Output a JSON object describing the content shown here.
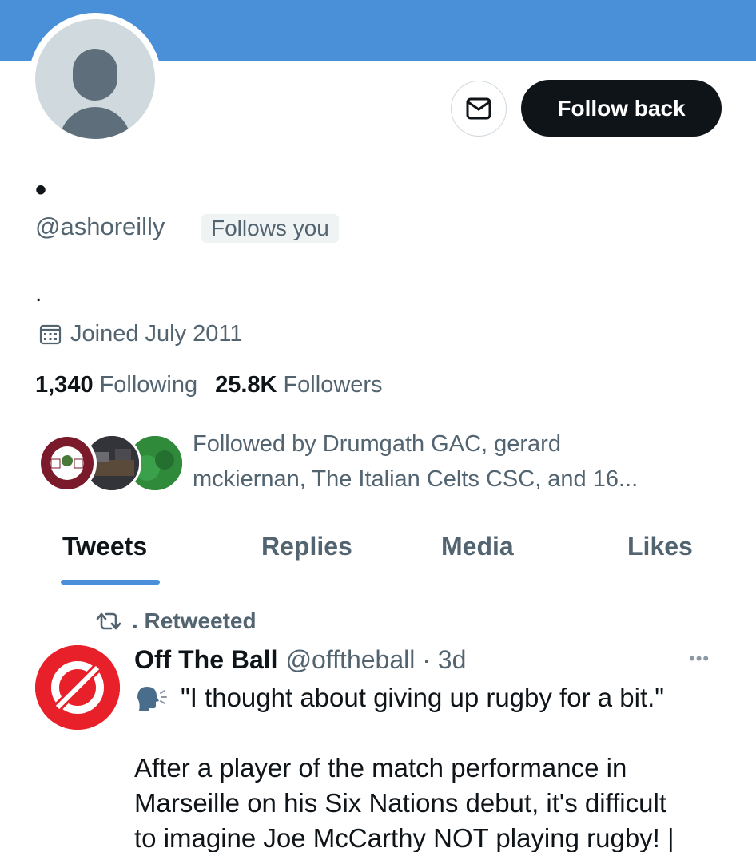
{
  "colors": {
    "banner": "#4a90d9",
    "primary_text": "#0f1419",
    "secondary_text": "#536471",
    "follow_button_bg": "#0f1419",
    "tab_indicator": "#4a8fda",
    "off_the_ball_red": "#e8202a"
  },
  "header": {
    "message_icon": "envelope-icon",
    "follow_button_label": "Follow back"
  },
  "profile": {
    "display_name": "•",
    "handle": "@ashoreilly",
    "follows_you_badge": "Follows you",
    "bio": ".",
    "joined_icon": "calendar-icon",
    "joined": "Joined July 2011",
    "following_count": "1,340",
    "following_label": "Following",
    "followers_count": "25.8K",
    "followers_label": "Followers",
    "followed_by_line1": "Followed by Drumgath GAC, gerard",
    "followed_by_line2": "mckiernan, The Italian Celts CSC, and 16..."
  },
  "tabs": [
    {
      "label": "Tweets",
      "active": true
    },
    {
      "label": "Replies",
      "active": false
    },
    {
      "label": "Media",
      "active": false
    },
    {
      "label": "Likes",
      "active": false
    }
  ],
  "tweet": {
    "retweet_icon": "retweet-icon",
    "retweeted_by": ". Retweeted",
    "author_name": "Off The Ball",
    "author_meta": "@offtheball · 3d",
    "more_icon": "more-icon",
    "speaking_icon": "speaking-head-icon",
    "text_line1": "\"I thought about giving up rugby for a bit.\"",
    "text_line2": "After a player of the match performance in",
    "text_line3": "Marseille on his Six Nations debut, it's difficult",
    "text_line4": "to imagine Joe McCarthy NOT playing rugby! |"
  }
}
